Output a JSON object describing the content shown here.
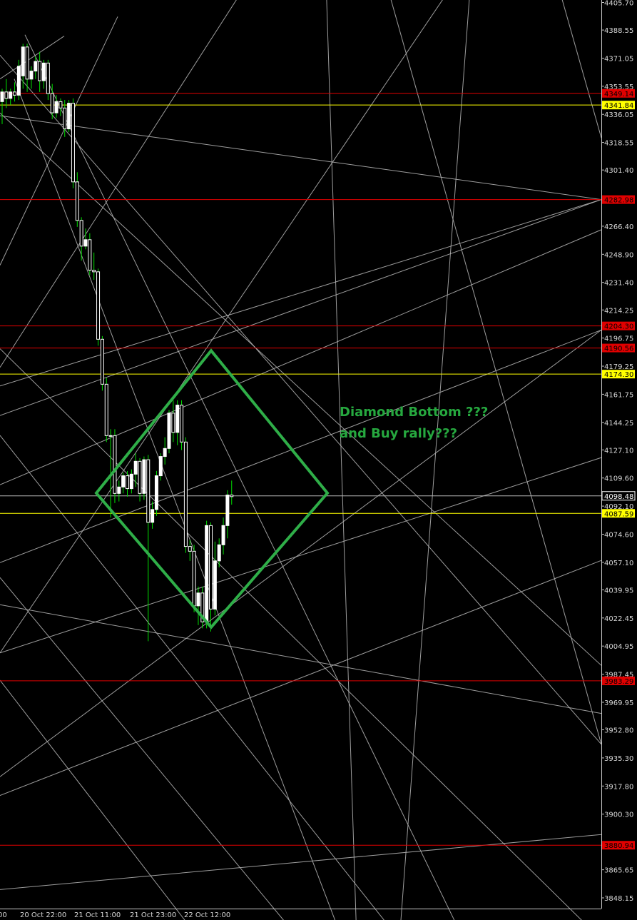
{
  "chart_data": {
    "type": "candlestick",
    "title": "",
    "instrument": "",
    "ylim": [
      3843.0,
      4408.0
    ],
    "y_ticks": [
      "4405.70",
      "4388.55",
      "4371.05",
      "4353.55",
      "4336.05",
      "4318.55",
      "4301.40",
      "4266.40",
      "4248.90",
      "4231.40",
      "4214.25",
      "4196.75",
      "4179.25",
      "4161.75",
      "4144.25",
      "4127.10",
      "4109.60",
      "4092.10",
      "4074.60",
      "4057.10",
      "4039.95",
      "4022.45",
      "4004.95",
      "3987.45",
      "3969.95",
      "3952.80",
      "3935.30",
      "3917.80",
      "3900.30",
      "3865.65",
      "3848.15"
    ],
    "x_ticks": [
      "00",
      "20 Oct 22:00",
      "21 Oct 11:00",
      "21 Oct 23:00",
      "22 Oct 12:00"
    ],
    "colors": {
      "background": "#000000",
      "candle": "#ffffff",
      "wick": "#00e000",
      "red_line": "#e00000",
      "yellow_line": "#ffff00",
      "grey_line": "#b8b8b8",
      "diamond": "#2fae48",
      "annotation": "#26a83f"
    },
    "horizontal_levels": [
      {
        "value": 4349.14,
        "label": "4349.14",
        "color": "red"
      },
      {
        "value": 4341.84,
        "label": "4341.84",
        "color": "yellow"
      },
      {
        "value": 4282.98,
        "label": "4282.98",
        "color": "red"
      },
      {
        "value": 4204.3,
        "label": "4204.30",
        "color": "red"
      },
      {
        "value": 4190.56,
        "label": "4190.56",
        "color": "red"
      },
      {
        "value": 4174.3,
        "label": "4174.30",
        "color": "yellow"
      },
      {
        "value": 4098.48,
        "label": "4098.48",
        "color": "grey"
      },
      {
        "value": 4087.59,
        "label": "4087.59",
        "color": "yellow"
      },
      {
        "value": 3983.29,
        "label": "3983.29",
        "color": "red"
      },
      {
        "value": 3880.94,
        "label": "3880.94",
        "color": "red"
      }
    ],
    "candles": [
      {
        "o": 4344,
        "h": 4352,
        "c": 4350,
        "l": 4330
      },
      {
        "o": 4350,
        "h": 4358,
        "c": 4346,
        "l": 4340
      },
      {
        "o": 4346,
        "h": 4352,
        "c": 4350,
        "l": 4342
      },
      {
        "o": 4350,
        "h": 4356,
        "c": 4348,
        "l": 4344
      },
      {
        "o": 4348,
        "h": 4370,
        "c": 4366,
        "l": 4345
      },
      {
        "o": 4360,
        "h": 4380,
        "c": 4378,
        "l": 4352
      },
      {
        "o": 4378,
        "h": 4380,
        "c": 4358,
        "l": 4350
      },
      {
        "o": 4358,
        "h": 4366,
        "c": 4363,
        "l": 4352
      },
      {
        "o": 4363,
        "h": 4372,
        "c": 4369,
        "l": 4358
      },
      {
        "o": 4369,
        "h": 4375,
        "c": 4357,
        "l": 4350
      },
      {
        "o": 4357,
        "h": 4370,
        "c": 4368,
        "l": 4352
      },
      {
        "o": 4368,
        "h": 4370,
        "c": 4349,
        "l": 4345
      },
      {
        "o": 4349,
        "h": 4355,
        "c": 4337,
        "l": 4333
      },
      {
        "o": 4337,
        "h": 4348,
        "c": 4344,
        "l": 4334
      },
      {
        "o": 4344,
        "h": 4346,
        "c": 4340,
        "l": 4335
      },
      {
        "o": 4340,
        "h": 4345,
        "c": 4327,
        "l": 4322
      },
      {
        "o": 4327,
        "h": 4345,
        "c": 4343,
        "l": 4325
      },
      {
        "o": 4343,
        "h": 4346,
        "c": 4294,
        "l": 4290
      },
      {
        "o": 4294,
        "h": 4300,
        "c": 4270,
        "l": 4266
      },
      {
        "o": 4270,
        "h": 4272,
        "c": 4254,
        "l": 4245
      },
      {
        "o": 4254,
        "h": 4265,
        "c": 4258,
        "l": 4252
      },
      {
        "o": 4258,
        "h": 4262,
        "c": 4239,
        "l": 4236
      },
      {
        "o": 4239,
        "h": 4250,
        "c": 4238,
        "l": 4233
      },
      {
        "o": 4238,
        "h": 4240,
        "c": 4196,
        "l": 4192
      },
      {
        "o": 4196,
        "h": 4198,
        "c": 4168,
        "l": 4164
      },
      {
        "o": 4168,
        "h": 4172,
        "c": 4136,
        "l": 4132
      },
      {
        "o": 4136,
        "h": 4140,
        "c": 4136,
        "l": 4085
      },
      {
        "o": 4136,
        "h": 4140,
        "c": 4100,
        "l": 4094
      },
      {
        "o": 4100,
        "h": 4108,
        "c": 4104,
        "l": 4095
      },
      {
        "o": 4104,
        "h": 4113,
        "c": 4111,
        "l": 4100
      },
      {
        "o": 4111,
        "h": 4114,
        "c": 4103,
        "l": 4098
      },
      {
        "o": 4103,
        "h": 4115,
        "c": 4112,
        "l": 4100
      },
      {
        "o": 4112,
        "h": 4125,
        "c": 4120,
        "l": 4104
      },
      {
        "o": 4120,
        "h": 4122,
        "c": 4100,
        "l": 4095
      },
      {
        "o": 4100,
        "h": 4123,
        "c": 4121,
        "l": 4096
      },
      {
        "o": 4121,
        "h": 4124,
        "c": 4082,
        "l": 4008
      },
      {
        "o": 4082,
        "h": 4095,
        "c": 4090,
        "l": 4078
      },
      {
        "o": 4090,
        "h": 4114,
        "c": 4111,
        "l": 4086
      },
      {
        "o": 4111,
        "h": 4125,
        "c": 4123,
        "l": 4108
      },
      {
        "o": 4123,
        "h": 4135,
        "c": 4128,
        "l": 4118
      },
      {
        "o": 4128,
        "h": 4152,
        "c": 4150,
        "l": 4125
      },
      {
        "o": 4150,
        "h": 4158,
        "c": 4138,
        "l": 4132
      },
      {
        "o": 4138,
        "h": 4158,
        "c": 4155,
        "l": 4130
      },
      {
        "o": 4155,
        "h": 4158,
        "c": 4132,
        "l": 4127
      },
      {
        "o": 4132,
        "h": 4135,
        "c": 4067,
        "l": 4063
      },
      {
        "o": 4067,
        "h": 4071,
        "c": 4064,
        "l": 4058
      },
      {
        "o": 4064,
        "h": 4068,
        "c": 4030,
        "l": 4026
      },
      {
        "o": 4030,
        "h": 4042,
        "c": 4038,
        "l": 4018
      },
      {
        "o": 4038,
        "h": 4042,
        "c": 4020,
        "l": 4016
      },
      {
        "o": 4020,
        "h": 4083,
        "c": 4080,
        "l": 4016
      },
      {
        "o": 4080,
        "h": 4082,
        "c": 4028,
        "l": 4014
      },
      {
        "o": 4028,
        "h": 4070,
        "c": 4058,
        "l": 4024
      },
      {
        "o": 4058,
        "h": 4072,
        "c": 4068,
        "l": 4054
      },
      {
        "o": 4068,
        "h": 4085,
        "c": 4080,
        "l": 4062
      },
      {
        "o": 4080,
        "h": 4102,
        "c": 4099,
        "l": 4072
      },
      {
        "o": 4099,
        "h": 4108,
        "c": 4098,
        "l": 4093
      }
    ],
    "diamond": [
      [
        135,
        4100.2
      ],
      [
        296,
        4188.9
      ],
      [
        459,
        4100.2
      ],
      [
        296,
        4016.7
      ]
    ],
    "angled_lines": [
      [
        [
          0,
          4358.1
        ],
        [
          90,
          4384.8
        ]
      ],
      [
        [
          0,
          4242.1
        ],
        [
          165,
          4396.9
        ]
      ],
      [
        [
          0,
          4178.5
        ],
        [
          350,
          4420.2
        ]
      ],
      [
        [
          0,
          4148.5
        ],
        [
          843,
          4283.0
        ]
      ],
      [
        [
          0,
          4105.4
        ],
        [
          843,
          4264.2
        ]
      ],
      [
        [
          0,
          4056.9
        ],
        [
          843,
          4201.8
        ]
      ],
      [
        [
          0,
          4166.9
        ],
        [
          843,
          4283.0
        ]
      ],
      [
        [
          0,
          3923.6
        ],
        [
          843,
          4201.8
        ]
      ],
      [
        [
          0,
          3911.9
        ],
        [
          843,
          4058.3
        ]
      ],
      [
        [
          0,
          3853.3
        ],
        [
          843,
          3887.6
        ]
      ],
      [
        [
          0,
          4030.7
        ],
        [
          843,
          3963.0
        ]
      ],
      [
        [
          0,
          4190.1
        ],
        [
          843,
          3822.2
        ]
      ],
      [
        [
          0,
          4000.7
        ],
        [
          640,
          4420.2
        ]
      ],
      [
        [
          0,
          4335.2
        ],
        [
          843,
          4283.0
        ]
      ],
      [
        [
          0,
          4372.9
        ],
        [
          843,
          3943.8
        ]
      ],
      [
        [
          20,
          4358.1
        ],
        [
          480,
          3822.2
        ]
      ],
      [
        [
          35,
          4385.6
        ],
        [
          650,
          3822.2
        ]
      ],
      [
        [
          0,
          4047.6
        ],
        [
          420,
          3822.2
        ]
      ],
      [
        [
          0,
          3983.7
        ],
        [
          280,
          3822.2
        ]
      ],
      [
        [
          0,
          4136.1
        ],
        [
          560,
          3822.2
        ]
      ],
      [
        [
          457,
          4420.2
        ],
        [
          500,
          3822.2
        ]
      ],
      [
        [
          540,
          4420.2
        ],
        [
          843,
          3943.8
        ]
      ],
      [
        [
          780,
          4420.2
        ],
        [
          843,
          4321.4
        ]
      ],
      [
        [
          0,
          4000.7
        ],
        [
          843,
          4122.3
        ]
      ],
      [
        [
          0,
          4336.9
        ],
        [
          843,
          3992.9
        ]
      ],
      [
        [
          660,
          4420.2
        ],
        [
          560,
          3822.2
        ]
      ]
    ],
    "last_price": "4098.48"
  },
  "annotation": {
    "line1": "Diamond Bottom ???",
    "line2": "and Buy rally???"
  }
}
